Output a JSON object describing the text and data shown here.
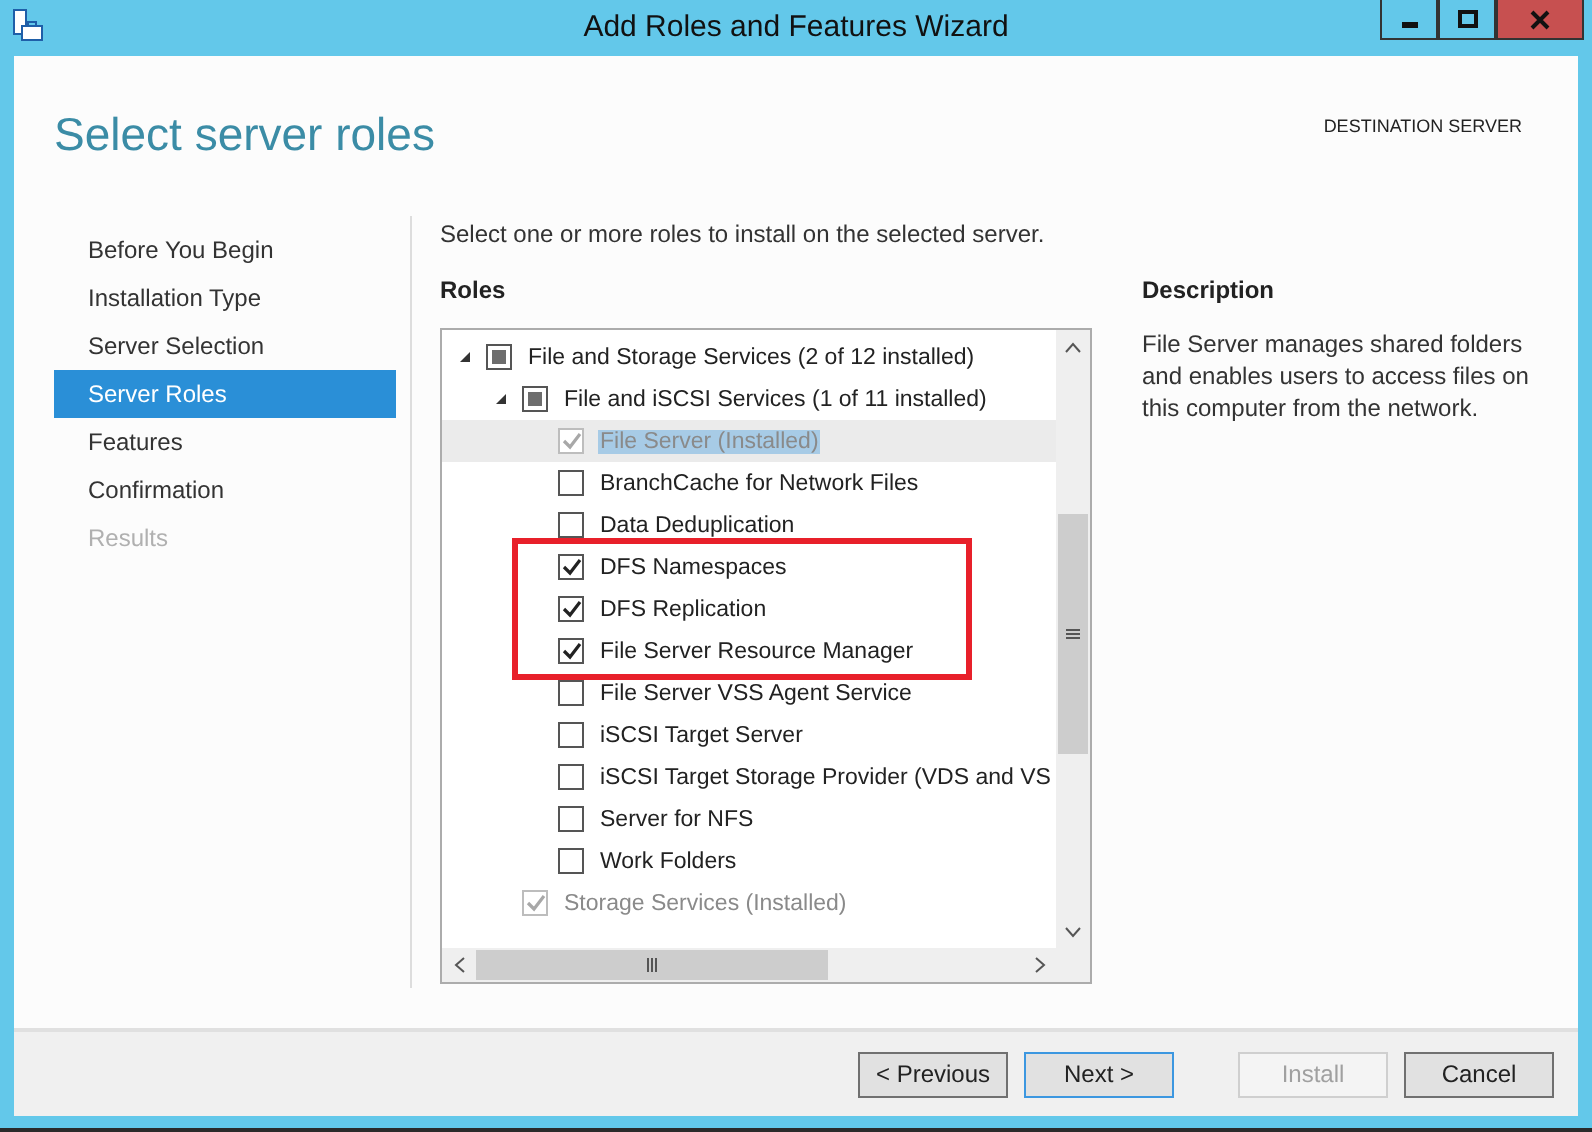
{
  "window": {
    "title": "Add Roles and Features Wizard"
  },
  "page_title": "Select server roles",
  "destination_label": "DESTINATION SERVER",
  "nav": [
    {
      "label": "Before You Begin",
      "selected": false,
      "disabled": false
    },
    {
      "label": "Installation Type",
      "selected": false,
      "disabled": false
    },
    {
      "label": "Server Selection",
      "selected": false,
      "disabled": false
    },
    {
      "label": "Server Roles",
      "selected": true,
      "disabled": false
    },
    {
      "label": "Features",
      "selected": false,
      "disabled": false
    },
    {
      "label": "Confirmation",
      "selected": false,
      "disabled": false
    },
    {
      "label": "Results",
      "selected": false,
      "disabled": true
    }
  ],
  "instruction": "Select one or more roles to install on the selected server.",
  "roles_heading": "Roles",
  "roles": [
    {
      "kind": "group",
      "label": "File and Storage Services (2 of 12 installed)",
      "checked": false,
      "disabled": false,
      "selected": false,
      "highlighted": false,
      "expanded": true,
      "children": [
        {
          "kind": "group",
          "label": "File and iSCSI Services (1 of 11 installed)",
          "checked": false,
          "disabled": false,
          "selected": false,
          "highlighted": false,
          "expanded": true,
          "children": [
            {
              "label": "File Server (Installed)",
              "checked": true,
              "disabled": true,
              "selected": true,
              "highlighted": false
            },
            {
              "label": "BranchCache for Network Files",
              "checked": false,
              "disabled": false,
              "selected": false,
              "highlighted": false
            },
            {
              "label": "Data Deduplication",
              "checked": false,
              "disabled": false,
              "selected": false,
              "highlighted": false
            },
            {
              "label": "DFS Namespaces",
              "checked": true,
              "disabled": false,
              "selected": false,
              "highlighted": true
            },
            {
              "label": "DFS Replication",
              "checked": true,
              "disabled": false,
              "selected": false,
              "highlighted": true
            },
            {
              "label": "File Server Resource Manager",
              "checked": true,
              "disabled": false,
              "selected": false,
              "highlighted": true
            },
            {
              "label": "File Server VSS Agent Service",
              "checked": false,
              "disabled": false,
              "selected": false,
              "highlighted": false
            },
            {
              "label": "iSCSI Target Server",
              "checked": false,
              "disabled": false,
              "selected": false,
              "highlighted": false
            },
            {
              "label": "iSCSI Target Storage Provider (VDS and VS",
              "checked": false,
              "disabled": false,
              "selected": false,
              "highlighted": false
            },
            {
              "label": "Server for NFS",
              "checked": false,
              "disabled": false,
              "selected": false,
              "highlighted": false
            },
            {
              "label": "Work Folders",
              "checked": false,
              "disabled": false,
              "selected": false,
              "highlighted": false
            }
          ]
        },
        {
          "label": "Storage Services (Installed)",
          "checked": true,
          "disabled": true,
          "selected": false,
          "highlighted": false
        }
      ]
    }
  ],
  "description_heading": "Description",
  "description": "File Server manages shared folders and enables users to access files on this computer from the network.",
  "buttons": [
    {
      "label": "< Previous",
      "disabled": false,
      "default": false
    },
    {
      "label": "Next >",
      "disabled": false,
      "default": true
    },
    {
      "label": "Install",
      "disabled": true,
      "default": false
    },
    {
      "label": "Cancel",
      "disabled": false,
      "default": false
    }
  ]
}
